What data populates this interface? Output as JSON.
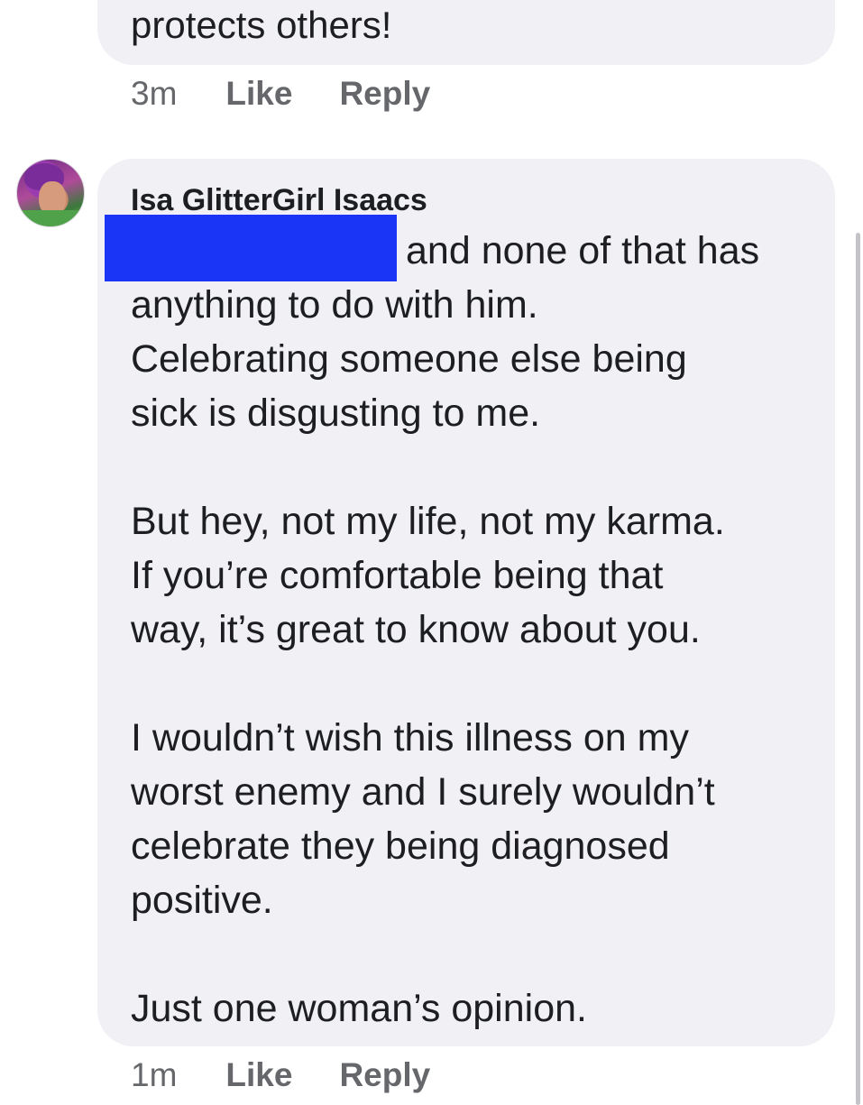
{
  "previous_comment": {
    "text_tail": "protects others!",
    "time": "3m",
    "like_label": "Like",
    "reply_label": "Reply"
  },
  "comment": {
    "author": "Isa GlitterGirl Isaacs",
    "first_line": "and none of that has",
    "paragraph1": [
      "anything to do with him.",
      "Celebrating someone else being",
      "sick is disgusting to me."
    ],
    "paragraph2": [
      "But hey, not my life, not my karma.",
      "If you’re comfortable being that",
      "way, it’s great to know about you."
    ],
    "paragraph3": [
      "I wouldn’t wish this illness on my",
      "worst enemy and I surely wouldn’t",
      "celebrate they being diagnosed",
      "positive."
    ],
    "paragraph4": [
      "Just one woman’s opinion."
    ],
    "time": "1m",
    "like_label": "Like",
    "reply_label": "Reply",
    "redaction_color": "#1a35f5"
  },
  "colors": {
    "bubble": "#f0f0f5",
    "text": "#1c1e21",
    "secondary": "#65676b"
  }
}
